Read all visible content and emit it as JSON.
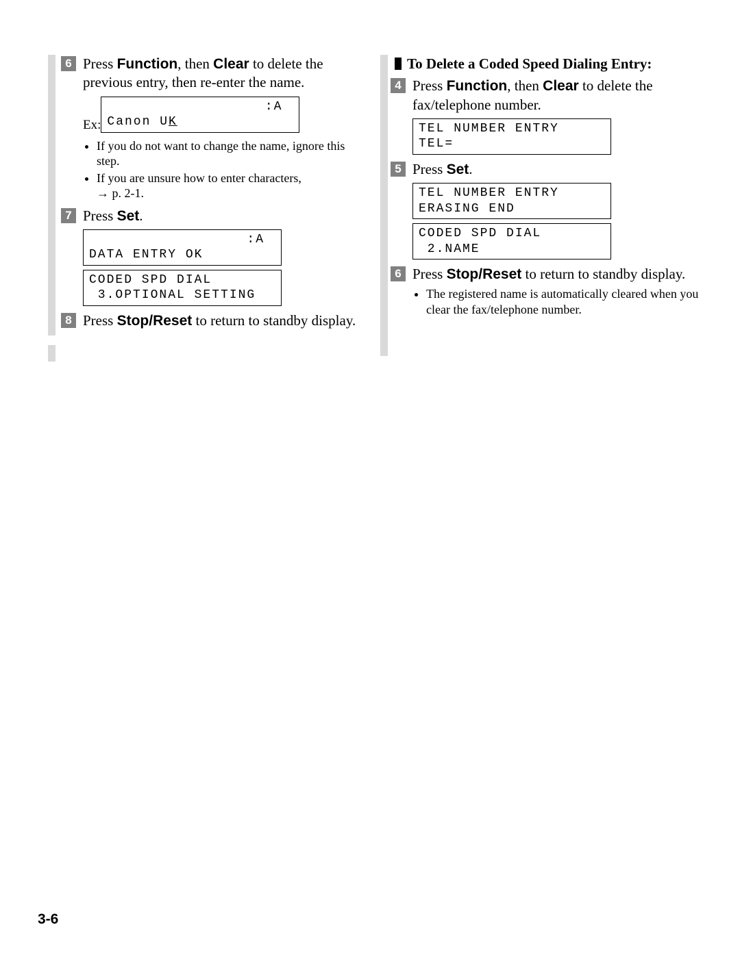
{
  "left": {
    "step6": {
      "press": "Press ",
      "func": "Function",
      "then": ", then ",
      "clear": "Clear",
      "rest": " to delete the previous entry, then re-enter the name."
    },
    "exLabel": "Ex:",
    "lcd6_line1": "                  :A",
    "lcd6_line2a": "Canon U",
    "lcd6_line2b": "K",
    "bullet6a": "If you do not want to change the name, ignore this step.",
    "bullet6b": "If you are unsure how to enter characters,",
    "bullet6b_ref": "→ p. 2-1.",
    "step7_press": "Press ",
    "step7_set": "Set",
    "step7_period": ".",
    "lcd7a_line1": "                  :A",
    "lcd7a_line2": "DATA ENTRY OK",
    "lcd7b_line1": "CODED SPD DIAL",
    "lcd7b_line2": " 3.OPTIONAL SETTING",
    "step8_press": "Press ",
    "step8_stop": "Stop/Reset",
    "step8_rest": " to return to standby display."
  },
  "right": {
    "heading": "To Delete a Coded Speed Dialing Entry:",
    "step4_press": "Press ",
    "step4_func": "Function",
    "step4_then": ", then ",
    "step4_clear": "Clear",
    "step4_rest": " to delete the fax/telephone number.",
    "lcd4_line1": "TEL NUMBER ENTRY",
    "lcd4_line2": "TEL=",
    "step5_press": "Press ",
    "step5_set": "Set",
    "step5_period": ".",
    "lcd5a_line1": "TEL NUMBER ENTRY",
    "lcd5a_line2": "ERASING END",
    "lcd5b_line1": "CODED SPD DIAL",
    "lcd5b_line2": " 2.NAME",
    "step6_press": "Press ",
    "step6_stop": "Stop/Reset",
    "step6_rest": " to return to standby display.",
    "bullet6": "The registered name is automatically cleared when you clear the fax/telephone number."
  },
  "pageNum": "3-6"
}
